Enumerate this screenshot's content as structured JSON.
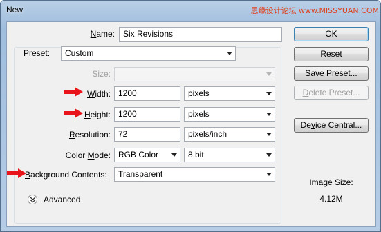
{
  "window": {
    "title": "New",
    "watermark": "思缘设计论坛 www.MISSYUAN.COM"
  },
  "form": {
    "name": {
      "label_pre": "",
      "label_u": "N",
      "label_post": "ame:",
      "value": "Six Revisions"
    },
    "preset": {
      "label_u": "P",
      "label_post": "reset:",
      "value": "Custom"
    },
    "size": {
      "label": "Size:",
      "value": ""
    },
    "width": {
      "label_u": "W",
      "label_post": "idth:",
      "value": "1200",
      "unit": "pixels"
    },
    "height": {
      "label_u": "H",
      "label_post": "eight:",
      "value": "1200",
      "unit": "pixels"
    },
    "resolution": {
      "label_u": "R",
      "label_post": "esolution:",
      "value": "72",
      "unit": "pixels/inch"
    },
    "color_mode": {
      "label_pre": "Color ",
      "label_u": "M",
      "label_post": "ode:",
      "value": "RGB Color",
      "bits": "8 bit"
    },
    "background": {
      "label_u": "B",
      "label_post": "ackground Contents:",
      "value": "Transparent"
    },
    "advanced": {
      "label": "Advanced"
    }
  },
  "buttons": {
    "ok": "OK",
    "reset": "Reset",
    "save_preset_u": "S",
    "save_preset_post": "ave Preset...",
    "delete_preset_u": "D",
    "delete_preset_post": "elete Preset...",
    "device_central_pre": "De",
    "device_central_u": "v",
    "device_central_post": "ice Central..."
  },
  "image_size": {
    "label": "Image Size:",
    "value": "4.12M"
  },
  "colors": {
    "arrow": "#e8131b",
    "title_gradient_top": "#b9cfe6",
    "client_bg": "#f0f0f0",
    "default_button_border": "#3c7fb1"
  },
  "icons": {
    "annotation_arrow": "red-arrow-icon",
    "advanced_toggle": "chevron-double-down-icon",
    "dropdown": "dropdown-arrow-icon"
  }
}
